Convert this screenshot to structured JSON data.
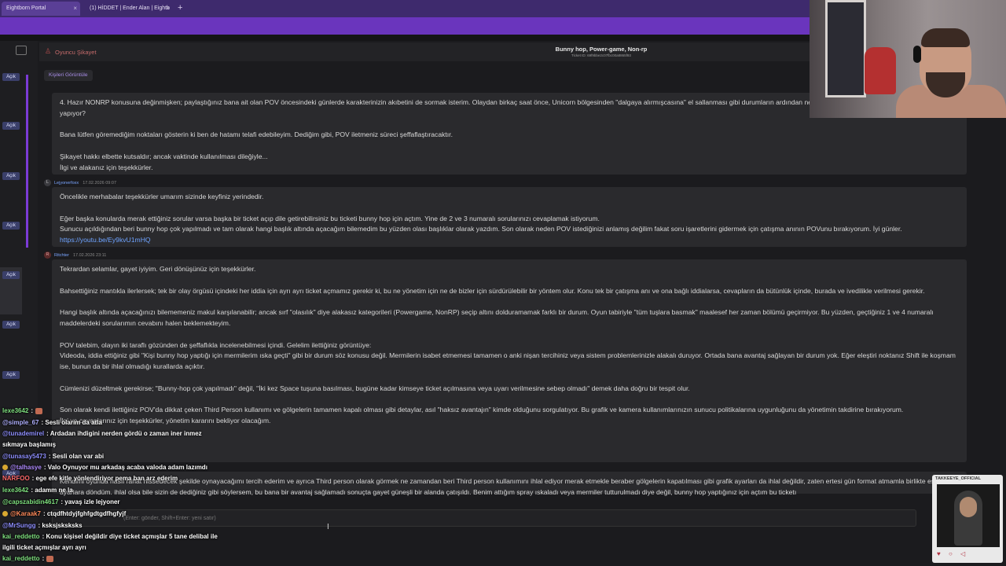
{
  "browser": {
    "tabs": [
      {
        "label": "Eightborn Portal"
      },
      {
        "label": "(1) HİDDET | Ender Alan | Eightb"
      }
    ],
    "new_tab": "+",
    "close": "×"
  },
  "sidebar": {
    "status_label": "Açık",
    "items": [
      "Açık",
      "Açık",
      "Açık",
      "Açık",
      "Açık",
      "Açık",
      "Açık",
      "Açık"
    ]
  },
  "ticket": {
    "category": "Oyuncu Şikayet",
    "title": "Bunny hop, Power-game, Non-rp",
    "ticket_id": "Ticket ID: 69f9bbe2c07fbc00a8865f93",
    "people_link": "Kişileri Görüntüle"
  },
  "messages": [
    {
      "author": "",
      "date": "",
      "paragraphs": [
        "4. Hazır NONRP konusuna değinmişken; paylaştığınız bana ait olan POV öncesindeki günlerde karakterinizin akıbetini de sormak isterim. Olaydan birkaç saat önce, Unicorn bölgesinden \"dalgaya alırmışcasına\" el sallanması gibi durumların ardından ne kadar süre aktif savaşta karakteriniz neler yapıyor?",
        "Bana lütfen göremediğim noktaları gösterin ki ben de hatamı telafi edebileyim. Dediğim gibi, POV iletmeniz süreci şeffaflaştıracaktır.",
        "Şikayet hakkı elbette kutsaldır; ancak vaktinde kullanılması dileğiyle...",
        "İlgi ve alakanız için teşekkürler."
      ]
    },
    {
      "author": "Lejyonerfoxx",
      "avatar": "L",
      "date": "17.02.2026 09:07",
      "paragraphs": [
        "Öncelikle merhabalar teşekkürler umarım sizinde keyfiniz yerindedir.",
        "Eğer başka konularda merak ettiğiniz sorular varsa başka bir ticket açıp dile getirebilirsiniz bu ticketi bunny hop için açtım. Yine de 2 ve 3 numaralı sorularınızı cevaplamak istiyorum.",
        "Sunucu açıldığından beri bunny hop çok yapılmadı ve tam olarak hangi başlık altında açacağım bilemedim bu yüzden olası başlıklar olarak yazdım. Son olarak neden POV istediğinizi anlamış değilim fakat soru işaretlerini gidermek için çatışma anının POVunu bırakıyorum. İyi günler."
      ],
      "link": "https://youtu.be/Ey9kvU1mHQ"
    },
    {
      "author": "Ritchter",
      "avatar": "R",
      "date": "17.02.2026 23:11",
      "paragraphs": [
        "Tekrardan selamlar, gayet iyiyim. Geri dönüşünüz için teşekkürler.",
        "Bahsettiğiniz mantıkla ilerlersek; tek bir olay örgüsü içindeki her iddia için ayrı ayrı ticket açmamız gerekir ki, bu ne yönetim için ne de bizler için sürdürülebilir bir yöntem olur. Konu tek bir çatışma anı ve ona bağlı iddialarsa, cevapların da bütünlük içinde, burada ve ivedilikle verilmesi gerekir.",
        "Hangi başlık altında açacağınızı bilememeniz makul karşılanabilir; ancak sırf \"olasılık\" diye alakasız kategorileri (Powergame, NonRP) seçip altını dolduramamak farklı bir durum. Oyun tabiriyle \"tüm tuşlara basmak\" maalesef her zaman bölümü geçirmiyor. Bu yüzden, geçtiğiniz 1 ve 4 numaralı maddelerdeki sorularımın cevabını halen beklemekteyim.",
        "POV talebim, olayın iki taraflı gözünden de şeffaflıkla incelenebilmesi içindi. Gelelim ilettiğiniz görüntüye:",
        "Videoda, iddia ettiğiniz gibi \"Kişi bunny hop yaptığı için mermilerim ıska geçti\" gibi bir durum söz konusu değil. Mermilerin isabet etmemesi tamamen o anki nişan tercihiniz veya sistem problemlerinizle alakalı duruyor. Ortada bana avantaj sağlayan bir durum yok. Eğer eleştiri noktanız Shift ile koşmam ise, bunun da bir ihlal olmadığı kurallarda açıktır.",
        "Cümlenizi düzeltmek gerekirse; \"Bunny-hop çok yapılmadı\" değil, \"İki kez Space tuşuna basılması, bugüne kadar kimseye ticket açılmasına veya uyarı verilmesine sebep olmadı\" demek daha doğru bir tespit olur.",
        "Son olarak kendi ilettiğiniz POV'da dikkat çeken Third Person kullanımı ve gölgelerin tamamen kapalı olması gibi detaylar, asıl \"haksız avantajın\" kimde olduğunu sorgulatıyor. Bu grafik ve kamera kullanımlarınızın sunucu politikalarına uygunluğunu da yönetimin takdirine bırakıyorum.",
        "İlgi ve cevaplarınız için teşekkürler, yönetim kararını bekliyor olacağım."
      ]
    },
    {
      "author": "",
      "date": "",
      "paragraphs": [
        "Kendimi oyunda nasıl rahat hissedecek şekilde oynayacağımı tercih ederim ve ayrıca Third person olarak görmek ne zamandan beri Third person kullanımını ihlal ediyor merak etmekle beraber gölgelerin kapatılması gibi grafik ayarları da ihlal değildir, zaten ertesi gün format atmamla birlikte eski ayarlara döndüm. ihlal olsa bile sizin de dediğiniz gibi söylersem, bu bana bir avantaj sağlamadı sonuçta gayet güneşli bir alanda çatışıldı. Benim attığım spray ıskaladı veya mermiler tutturulmadı diye değil, bunny hop yaptığınız için açtım bu ticketı"
      ]
    }
  ],
  "reply": {
    "placeholder": "(Enter: gönder, Shift+Enter: yeni satır)"
  },
  "profile_card": {
    "name": "TAKKEEYE_OFFICIAL",
    "icons": "♥ ○ ◁"
  },
  "chat": [
    {
      "name": "lexe3642",
      "text": ":",
      "emote": true,
      "color": "#7fe07f"
    },
    {
      "name": "@simple_67",
      "text": ": Sesli olarım da atla",
      "color": "#b0b0ff"
    },
    {
      "name": "@tunademirel",
      "text": ": Ardadan ihdigini nerden gördü o zaman iner inmez",
      "color": "#8f8fff"
    },
    {
      "name": "",
      "text": "sıkmaya başlamış",
      "color": "#ffffff"
    },
    {
      "name": "@tunasay5473",
      "text": ": Sesli olan var abi",
      "color": "#8f8fff"
    },
    {
      "name": "@talhasye",
      "text": ": Valo Oynuyor mu arkadaş acaba valoda adam lazımdı",
      "color": "#b08cff",
      "badge": true
    },
    {
      "name": "NARFOO",
      "text": ": ege efe kitle yönlendiriyor pema ban arz ederim",
      "color": "#ff6a6a"
    },
    {
      "name": "lexe3642",
      "text": ": adamm ne la",
      "color": "#7fe07f"
    },
    {
      "name": "@capszabidin4617",
      "text": ": yavaş izle lejyoner",
      "color": "#7fe07f"
    },
    {
      "name": "@Karaak7",
      "text": ": ctqdfhtdyjfghfgdtgdfhgfyjf",
      "color": "#ff8a5a",
      "badge": true
    },
    {
      "name": "@MrSungg",
      "text": ": ksksjsksksks",
      "color": "#8f8fff"
    },
    {
      "name": "kai_reddetto",
      "text": ": Konu kişisel değildir diye ticket açmışlar 5 tane delibal ile",
      "color": "#7fe07f"
    },
    {
      "name": "",
      "text": "ilgili ticket açmışlar ayrı ayrı",
      "color": "#ffffff"
    },
    {
      "name": "kai_reddetto",
      "text": ":",
      "emote": true,
      "color": "#7fe07f"
    }
  ]
}
